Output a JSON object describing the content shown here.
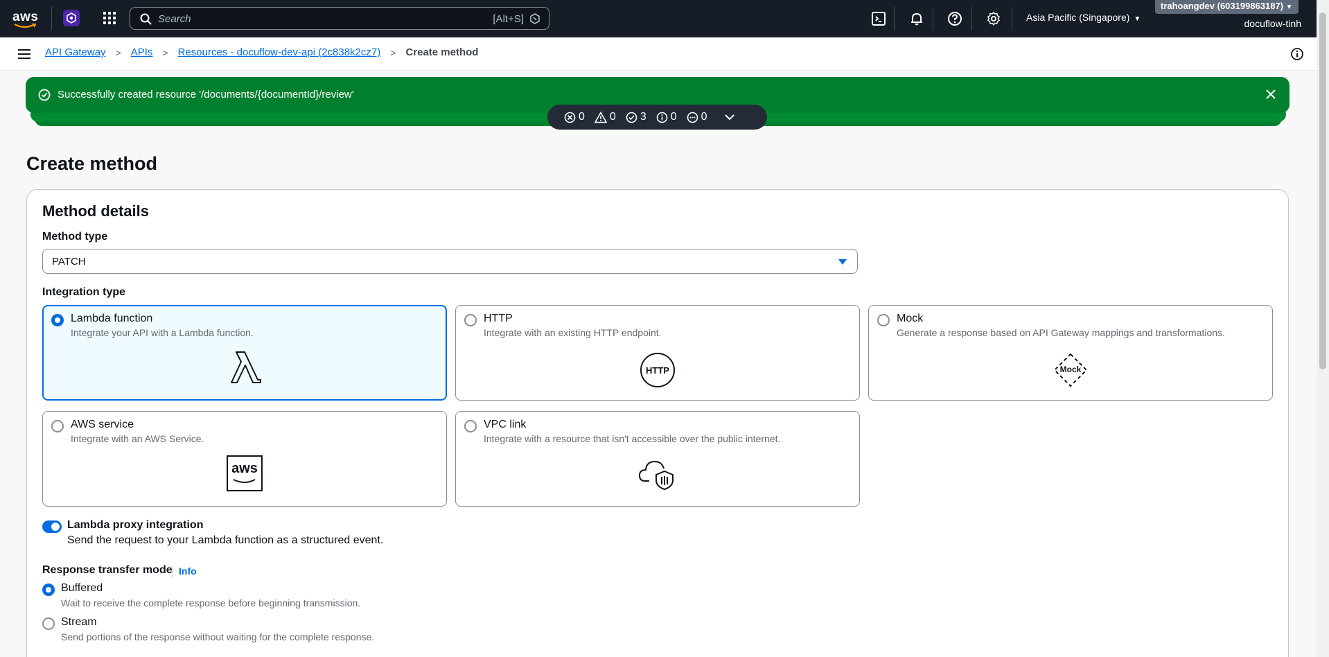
{
  "topnav": {
    "logo_text": "aws",
    "search_placeholder": "Search",
    "search_shortcut": "[Alt+S]",
    "region": "Asia Pacific (Singapore)",
    "account": "trahoangdev (603199863187)",
    "user": "docuflow-tinh"
  },
  "breadcrumb": {
    "items": [
      "API Gateway",
      "APIs",
      "Resources - docuflow-dev-api (2c838k2cz7)"
    ],
    "current": "Create method"
  },
  "flash": {
    "message": "Successfully created resource '/documents/{documentId}/review'",
    "counts": {
      "error": "0",
      "warning": "0",
      "success": "3",
      "info": "0",
      "progress": "0"
    }
  },
  "page": {
    "title": "Create method",
    "panel_title": "Method details",
    "method_type_label": "Method type",
    "method_type_value": "PATCH",
    "integration_type_label": "Integration type",
    "integration_types": [
      {
        "title": "Lambda function",
        "desc": "Integrate your API with a Lambda function.",
        "selected": true
      },
      {
        "title": "HTTP",
        "desc": "Integrate with an existing HTTP endpoint.",
        "icon_text": "HTTP"
      },
      {
        "title": "Mock",
        "desc": "Generate a response based on API Gateway mappings and transformations.",
        "icon_text": "Mock"
      },
      {
        "title": "AWS service",
        "desc": "Integrate with an AWS Service.",
        "icon_text": "aws"
      },
      {
        "title": "VPC link",
        "desc": "Integrate with a resource that isn't accessible over the public internet."
      }
    ],
    "proxy_title": "Lambda proxy integration",
    "proxy_desc": "Send the request to your Lambda function as a structured event.",
    "rtm_label": "Response transfer mode",
    "rtm_info": "Info",
    "rtm_options": [
      {
        "title": "Buffered",
        "desc": "Wait to receive the complete response before beginning transmission.",
        "selected": true
      },
      {
        "title": "Stream",
        "desc": "Send portions of the response without waiting for the complete response."
      }
    ]
  },
  "colors": {
    "nav_bg": "#161d26",
    "accent": "#006ce0",
    "success": "#00802f"
  }
}
